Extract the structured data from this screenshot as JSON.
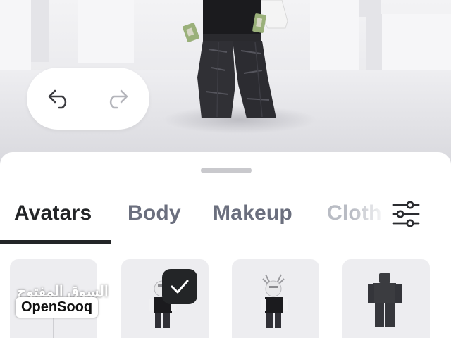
{
  "scene": {
    "avatar": "3d-avatar-preview",
    "undo_icon": "undo-icon",
    "redo_icon": "redo-icon",
    "redo_enabled": false
  },
  "tabs": [
    {
      "label": "Avatars",
      "active": true
    },
    {
      "label": "Body",
      "active": false
    },
    {
      "label": "Makeup",
      "active": false
    },
    {
      "label": "Clothing",
      "active": false
    }
  ],
  "filter_icon": "sliders-icon",
  "cards": [
    {
      "icon": "avatar-thumbnail",
      "selected": false
    },
    {
      "icon": "avatar-thumbnail",
      "selected": true
    },
    {
      "icon": "avatar-thumbnail",
      "selected": false
    },
    {
      "icon": "default-body-thumbnail",
      "selected": false
    }
  ],
  "watermark": {
    "arabic": "السوق المفتوح",
    "latin": "OpenSooq"
  },
  "colors": {
    "tab_active": "#232527",
    "tab_inactive": "#6b6f7e",
    "card_bg": "#ededf0",
    "badge_bg": "#232527"
  }
}
